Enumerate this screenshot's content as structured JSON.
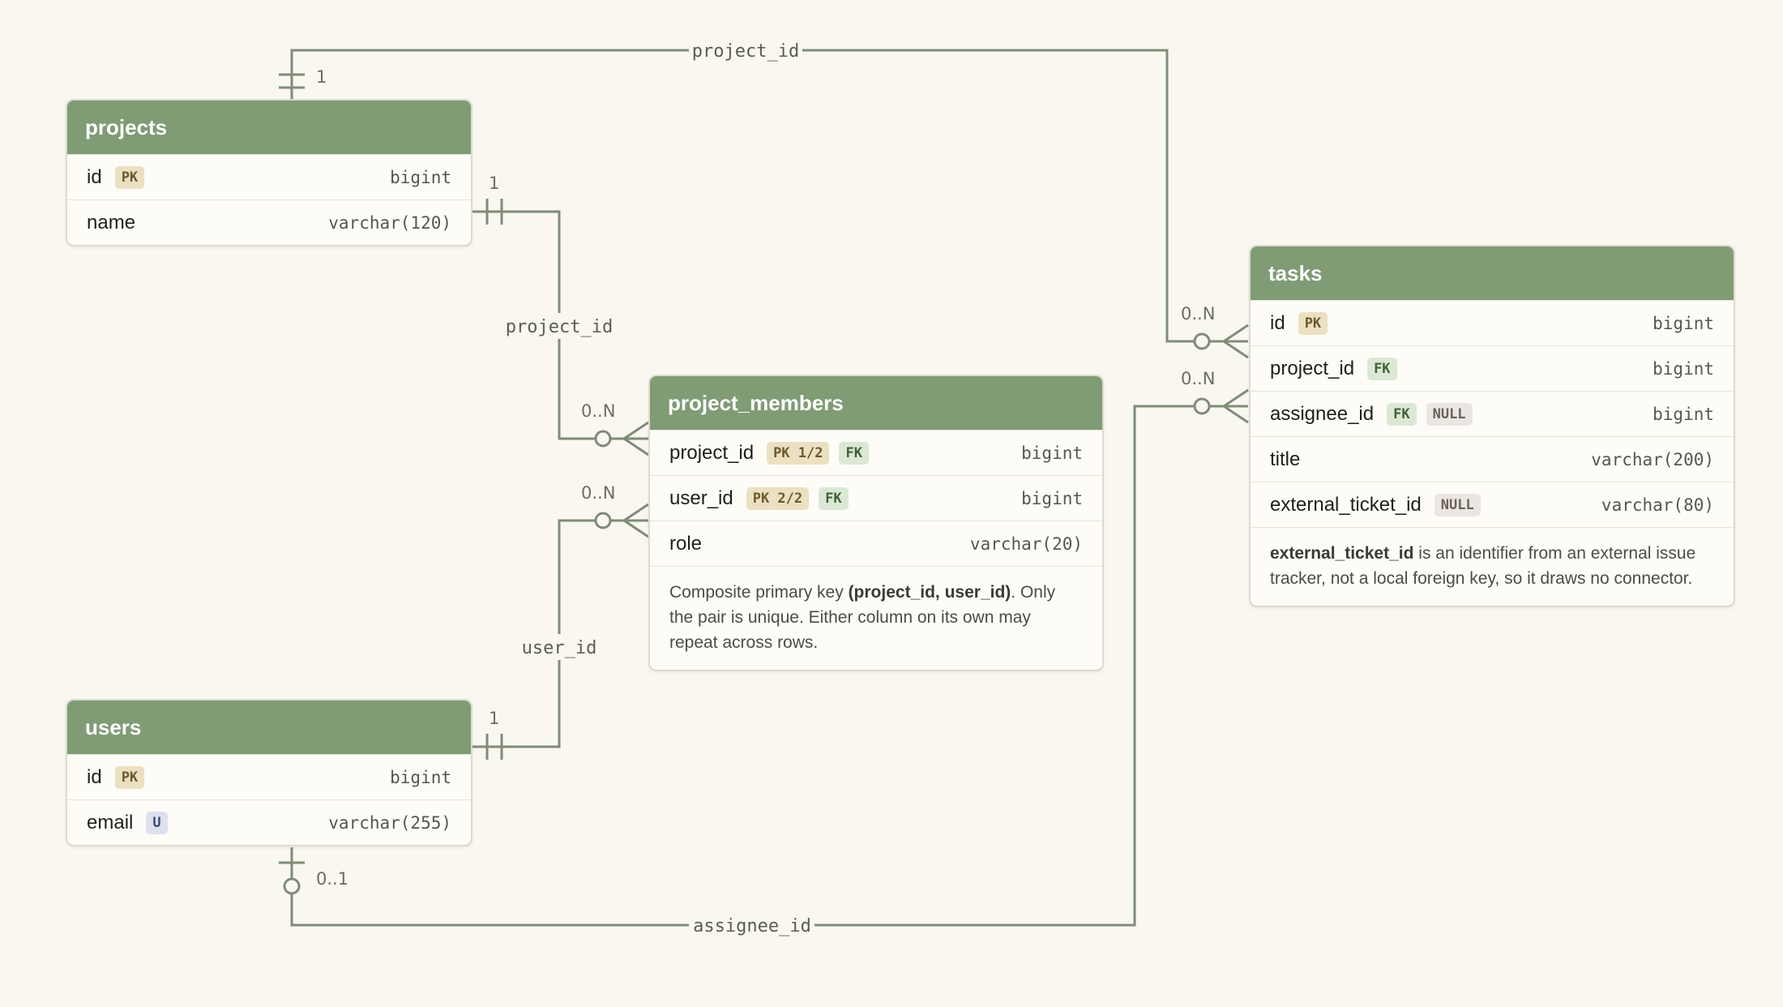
{
  "entities": {
    "projects": {
      "title": "projects",
      "rows": [
        {
          "name": "id",
          "badge": "PK",
          "type": "bigint"
        },
        {
          "name": "name",
          "type": "varchar(120)"
        }
      ]
    },
    "users": {
      "title": "users",
      "rows": [
        {
          "name": "id",
          "badge": "PK",
          "type": "bigint"
        },
        {
          "name": "email",
          "badge": "U",
          "type": "varchar(255)"
        }
      ]
    },
    "project_members": {
      "title": "project_members",
      "rows": [
        {
          "name": "project_id",
          "badge1": "PK 1/2",
          "badge2": "FK",
          "type": "bigint"
        },
        {
          "name": "user_id",
          "badge1": "PK 2/2",
          "badge2": "FK",
          "type": "bigint"
        },
        {
          "name": "role",
          "type": "varchar(20)"
        }
      ],
      "note": {
        "prefix": "Composite primary key ",
        "bold": "(project_id, user_id)",
        "suffix": ". Only the pair is unique. Either column on its own may repeat across rows."
      }
    },
    "tasks": {
      "title": "tasks",
      "rows": [
        {
          "name": "id",
          "badge": "PK",
          "type": "bigint"
        },
        {
          "name": "project_id",
          "badge": "FK",
          "type": "bigint"
        },
        {
          "name": "assignee_id",
          "badge1": "FK",
          "badge2": "NULL",
          "type": "bigint"
        },
        {
          "name": "title",
          "type": "varchar(200)"
        },
        {
          "name": "external_ticket_id",
          "badge": "NULL",
          "type": "varchar(80)"
        }
      ],
      "note": {
        "bold": "external_ticket_id",
        "suffix": " is an identifier from an external issue tracker, not a local foreign key, so it draws no connector."
      }
    }
  },
  "relationships": [
    {
      "label": "project_id",
      "from": "projects.id",
      "to": "tasks.project_id",
      "from_cardinality": "1",
      "to_cardinality": "0..N"
    },
    {
      "label": "project_id",
      "from": "projects.id",
      "to": "project_members.project_id",
      "from_cardinality": "1",
      "to_cardinality": "0..N"
    },
    {
      "label": "user_id",
      "from": "users.id",
      "to": "project_members.user_id",
      "from_cardinality": "1",
      "to_cardinality": "0..N"
    },
    {
      "label": "assignee_id",
      "from": "users.id",
      "to": "tasks.assignee_id",
      "from_cardinality": "0..1",
      "to_cardinality": "0..N"
    }
  ],
  "colors": {
    "background": "#f9f7f0",
    "header": "#7f9c75",
    "line": "#7f8c77",
    "pk_badge": "#ece0c2",
    "fk_badge": "#dce8d6",
    "null_badge": "#ebe6e1",
    "unique_badge": "#dde0ee"
  }
}
